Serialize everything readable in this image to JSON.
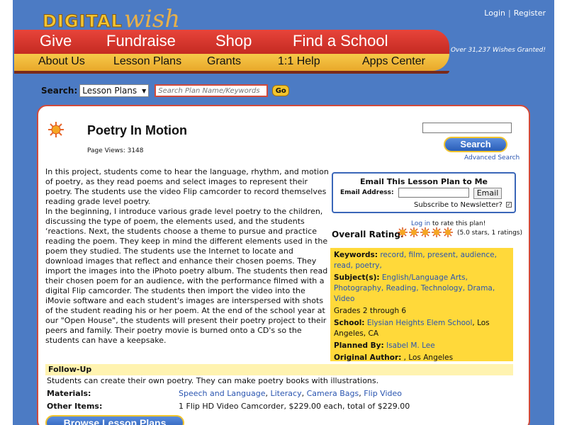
{
  "brand": {
    "logo_part1": "DIGITAL",
    "logo_part2": "wish"
  },
  "top_links": {
    "login": "Login",
    "sep": "|",
    "register": "Register"
  },
  "nav_primary": [
    "Give",
    "Fundraise",
    "Shop",
    "Find a School"
  ],
  "nav_secondary": [
    "About Us",
    "Lesson Plans",
    "Grants",
    "1:1 Help",
    "Apps Center"
  ],
  "wishes_granted": "Over 31,237 Wishes Granted!",
  "search": {
    "label": "Search:",
    "select_value": "Lesson Plans",
    "placeholder": "Search Plan Name/Keywords",
    "go_label": "Go"
  },
  "lesson": {
    "title": "Poetry In Motion",
    "page_views": "Page Views: 3148",
    "body_p1": "In this project, students come to hear the language, rhythm, and motion of poetry, as they read poems and select images to represent their poetry. The students use the video Flip camcorder to record themselves reading grade level poetry.",
    "body_p2": "In the beginning, I introduce various grade level poetry to the children, discussing the type of poem, the elements used, and the students ‘reactions. Next, the students choose a theme to pursue and practice reading the poem. They keep in mind the different elements used in the poem they studied. The students use the Internet to locate and download images that reflect and enhance their chosen poems. They import the images into the iPhoto poetry album. The students then read their chosen poem for an audience, with the performance filmed with a digital Flip camcorder. The students then import the video into the iMovie software and each student's images are interspersed with shots of the student reading his or her poem. At the end of the school year at our \"Open House\", the students will present their poetry project to their peers and family. Their poetry movie is burned onto a CD's so the students can have a keepsake."
  },
  "right_search": {
    "button": "Search",
    "advanced": "Advanced Search"
  },
  "email_box": {
    "title": "Email This Lesson Plan to Me",
    "address_label": "Email Address:",
    "button": "Email",
    "subscribe": "Subscribe to Newsletter?"
  },
  "rating": {
    "login_link": "Log in",
    "login_suffix": " to rate this plan!",
    "label": "Overall Rating:",
    "stars": 5,
    "summary": "(5.0 stars, 1 ratings)"
  },
  "meta": {
    "keywords_label": "Keywords:",
    "keywords": "record, film, present, audience, read, poetry,",
    "subjects_label": "Subject(s):",
    "subjects": "English/Language Arts, Photography, Reading, Technology, Drama, Video",
    "grades": "Grades 2 through 6",
    "school_label": "School:",
    "school": "Elysian Heights Elem School",
    "school_loc": ", Los Angeles, CA",
    "planned_label": "Planned By:",
    "planned": "Isabel M. Lee",
    "author_label": "Original Author:",
    "author": ", Los Angeles"
  },
  "followup": {
    "heading": "Follow-Up",
    "text": "Students can create their own poetry. They can make poetry books with illustrations.",
    "materials_label": "Materials:",
    "materials_link1": "Speech and Language",
    "materials_link2": "Literacy",
    "materials_link3": "Camera Bags",
    "materials_link4": "Flip Video",
    "other_label": "Other Items:",
    "other_value": "1 Flip HD Video Camcorder, $229.00 each, total of $229.00"
  },
  "browse_button": "Browse Lesson Plans",
  "colors": {
    "frame_blue": "#4c7bc4",
    "nav_red": "#e8443a",
    "nav_yellow": "#f6c94a",
    "meta_yellow": "#ffd93a",
    "link_blue": "#2a55b0"
  },
  "icons": {
    "title": "sun-icon",
    "rating": "star-icon"
  }
}
